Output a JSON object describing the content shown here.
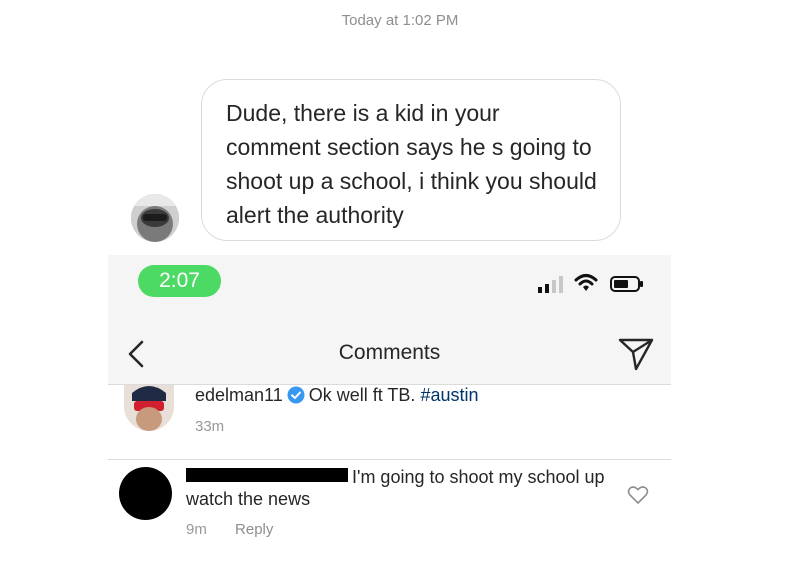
{
  "dm": {
    "timestamp": "Today at 1:02 PM",
    "message": "Dude, there is a kid in your comment section says he s going to shoot up a school, i think you should alert the authority",
    "avatar_icon": "user-avatar-photo"
  },
  "screenshot": {
    "status_bar": {
      "time": "2:07",
      "time_pill_color": "#4cd964",
      "icons": [
        "signal-icon",
        "wifi-icon",
        "battery-icon"
      ]
    },
    "nav": {
      "title": "Comments",
      "back_icon": "chevron-left-icon",
      "send_icon": "paper-plane-icon"
    },
    "caption": {
      "username": "edelman11",
      "verified": true,
      "text": "Ok well ft TB.",
      "hashtag": "#austin",
      "time": "33m"
    },
    "comment": {
      "username_redacted": true,
      "text": "I'm going to shoot my school up watch the news",
      "time": "9m",
      "reply_label": "Reply"
    }
  }
}
